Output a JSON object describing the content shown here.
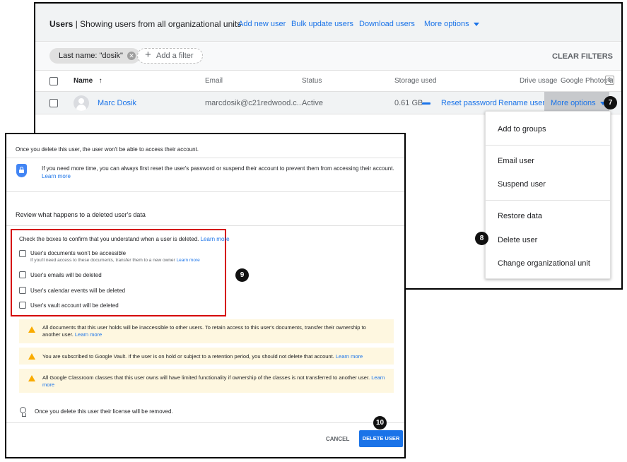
{
  "users_page": {
    "title_bold": "Users",
    "title_rest": " | Showing users from all organizational units",
    "links": [
      "Add new user",
      "Bulk update users",
      "Download users",
      "More options"
    ],
    "filter_chip": "Last name: \"dosik\"",
    "add_filter": "Add a filter",
    "clear_filters": "CLEAR FILTERS",
    "columns": {
      "name": "Name",
      "sort_arrow": "↑",
      "email": "Email",
      "status": "Status",
      "storage": "Storage used",
      "drive": "Drive usage",
      "photos": "Google Photos u"
    },
    "row": {
      "name": "Marc Dosik",
      "email": "marcdosik@c21redwood.c...",
      "status": "Active",
      "storage": "0.61 GB",
      "reset_password": "Reset password",
      "rename_user": "Rename user",
      "more_options": "More options"
    },
    "menu": [
      "Add to groups",
      "Email user",
      "Suspend user",
      "Restore data",
      "Delete user",
      "Change organizational unit"
    ]
  },
  "dialog": {
    "intro": "Once you delete this user, the user won't be able to access their account.",
    "info_text": "If you need more time, you can always first reset the user's password or suspend their account to prevent them from accessing their account.",
    "info_link": "Learn more",
    "review_heading": "Review what happens to a deleted user's data",
    "confirm_text": "Check the boxes to confirm that you understand when a user is deleted.",
    "confirm_link": "Learn more",
    "checkboxes": [
      "User's documents won't be accessible",
      "User's emails will be deleted",
      "User's calendar events will be deleted",
      "User's vault account will be deleted"
    ],
    "doc_sub": "If you'll need access to these documents, transfer them to a new owner",
    "doc_sub_link": "Learn more",
    "warnings": [
      {
        "text": "All documents that this user holds will be inaccessible to other users. To retain access to this user's documents, transfer their ownership to another user.",
        "link": "Learn more"
      },
      {
        "text": "You are subscribed to Google Vault. If the user is on hold or subject to a retention period, you should not delete that account.",
        "link": "Learn more"
      },
      {
        "text": "All Google Classroom classes that this user owns will have limited functionality if ownership of the classes is not transferred to another user.",
        "link": "Learn more"
      }
    ],
    "license_note": "Once you delete this user their license will be removed.",
    "cancel": "CANCEL",
    "delete": "DELETE USER"
  },
  "badges": [
    "7",
    "8",
    "9",
    "10"
  ],
  "icons": {
    "x_glyph": "✕",
    "plus_glyph": "+",
    "gear_glyph": "⚙"
  }
}
